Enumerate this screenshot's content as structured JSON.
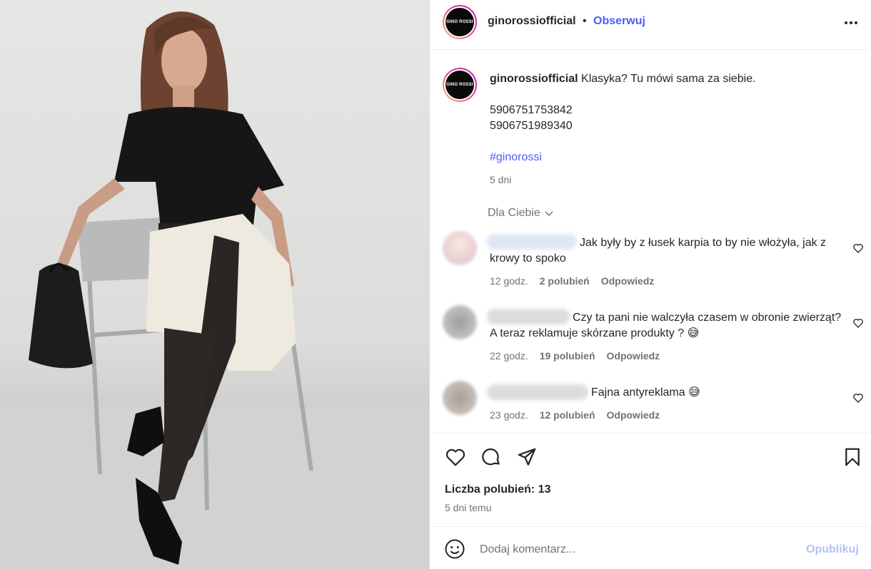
{
  "post": {
    "username": "ginorossiofficial",
    "separator": "•",
    "follow_label": "Obserwuj",
    "avatar_text": "GINO ROSSI"
  },
  "caption": {
    "username": "ginorossiofficial",
    "text": "Klasyka? Tu mówi sama za siebie.",
    "codes": [
      "5906751753842",
      "5906751989340"
    ],
    "hashtag": "#ginorossi",
    "age": "5 dni"
  },
  "sort_label": "Dla Ciebie",
  "comments": [
    {
      "text": "Jak były by z łusek karpia to by nie włożyła, jak z krowy to spoko",
      "time": "12 godz.",
      "likes": "2 polubień",
      "reply": "Odpowiedz"
    },
    {
      "text": "Czy ta pani nie walczyła czasem w obronie zwierząt? A teraz reklamuje skórzane produkty ? 😅",
      "time": "22 godz.",
      "likes": "19 polubień",
      "reply": "Odpowiedz"
    },
    {
      "text": "Fajna antyreklama 😅",
      "time": "23 godz.",
      "likes": "12 polubień",
      "reply": "Odpowiedz"
    }
  ],
  "likes_count": "Liczba polubień: 13",
  "posted_ago": "5 dni temu",
  "comment_box": {
    "placeholder": "Dodaj komentarz...",
    "post_label": "Opublikuj"
  },
  "colors": {
    "link": "#4a5df9",
    "muted": "#737373",
    "post_disabled": "#b3c3f6"
  }
}
